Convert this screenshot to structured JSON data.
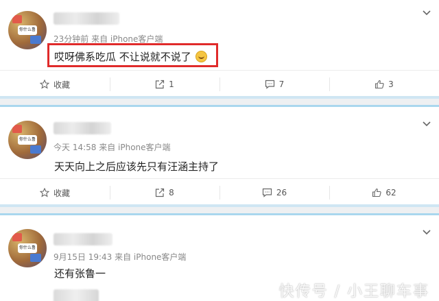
{
  "posts": [
    {
      "avatar_text": "你什么鲁",
      "meta": "23分钟前 来自 iPhone客户端",
      "content": "哎呀佛系吃瓜 不让说就不说了",
      "actions": {
        "favorite": "收藏",
        "repost": "1",
        "comment": "7",
        "like": "3"
      }
    },
    {
      "avatar_text": "你什么鲁",
      "meta": "今天 14:58 来自 iPhone客户端",
      "content": "天天向上之后应该先只有汪涵主持了",
      "actions": {
        "favorite": "收藏",
        "repost": "8",
        "comment": "26",
        "like": "62"
      }
    },
    {
      "avatar_text": "你什么鲁",
      "meta": "9月15日 19:43 来自 iPhone客户端",
      "content": "还有张鲁一"
    }
  ],
  "watermark": "快传号 / 小王聊车事",
  "colors": {
    "highlight_border": "#e02a2a",
    "separator": "#cfe6f3"
  }
}
